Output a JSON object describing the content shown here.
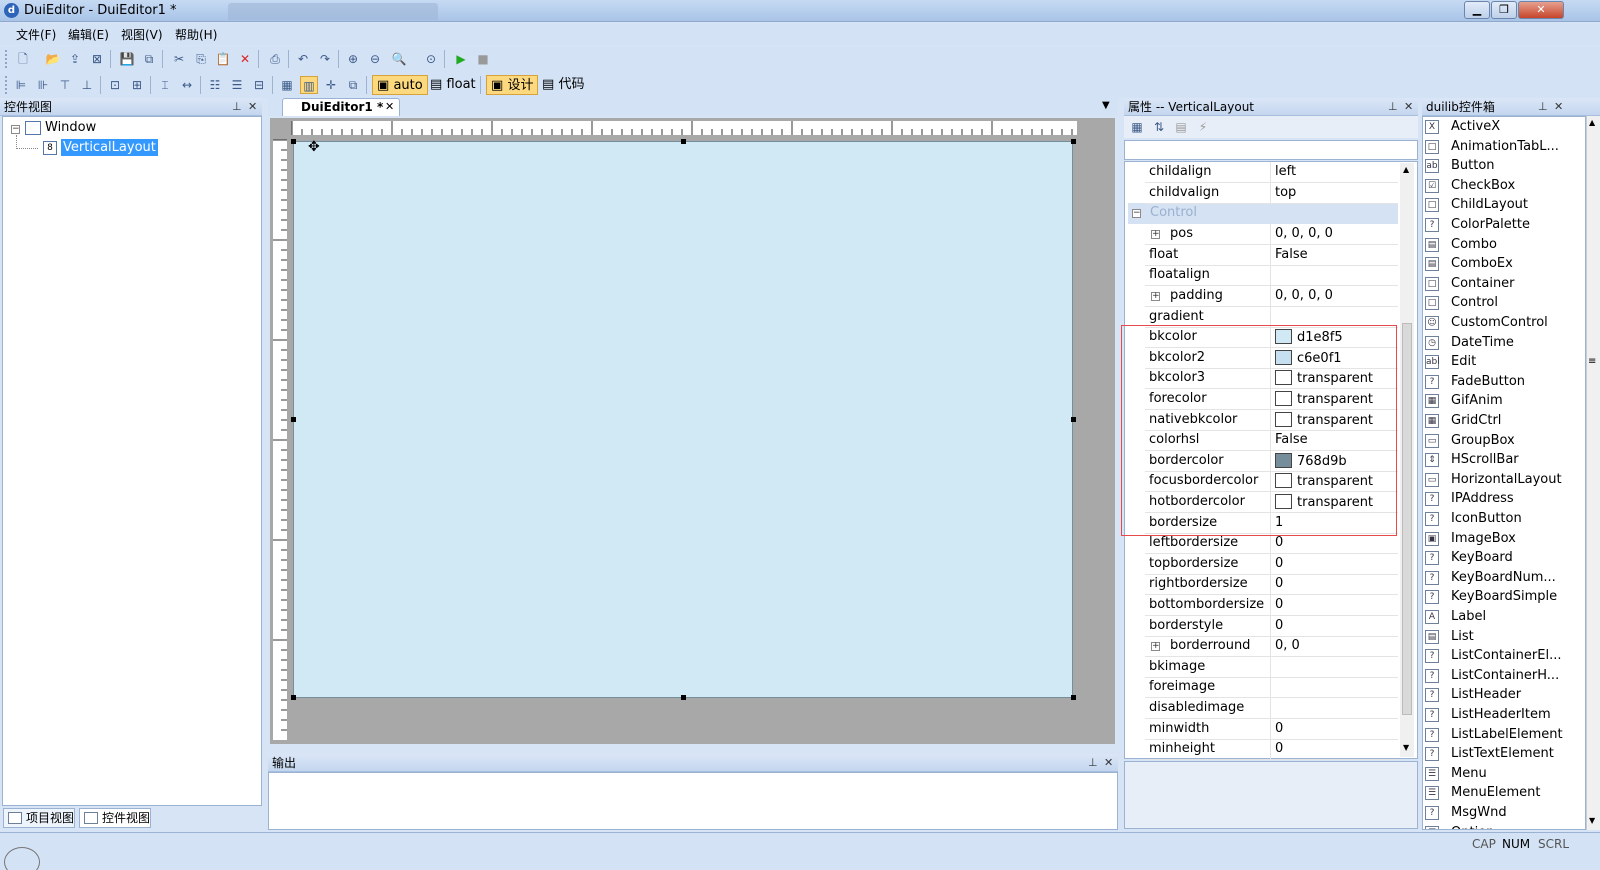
{
  "titlebar": {
    "title": "DuiEditor - DuiEditor1 *"
  },
  "menu": [
    "文件(F)",
    "编辑(E)",
    "视图(V)",
    "帮助(H)"
  ],
  "toolbar2": {
    "auto": "auto",
    "float": "float",
    "design": "设计",
    "code": "代码"
  },
  "control_view": {
    "title": "控件视图",
    "tree": [
      {
        "label": "Window"
      },
      {
        "label": "VerticalLayout"
      }
    ],
    "bottom_tabs": [
      "项目视图",
      "控件视图"
    ]
  },
  "editor": {
    "tab": "DuiEditor1 *"
  },
  "output": {
    "title": "输出"
  },
  "properties": {
    "title": "属性 -- VerticalLayout",
    "section": "Control",
    "rows": [
      {
        "name": "childalign",
        "value": "left"
      },
      {
        "name": "childvalign",
        "value": "top"
      },
      {
        "name": "pos",
        "value": "0, 0, 0, 0",
        "expander": "+"
      },
      {
        "name": "float",
        "value": "False"
      },
      {
        "name": "floatalign",
        "value": ""
      },
      {
        "name": "padding",
        "value": "0, 0, 0, 0",
        "expander": "+"
      },
      {
        "name": "gradient",
        "value": ""
      },
      {
        "name": "bkcolor",
        "value": "d1e8f5",
        "swatch": "#d1e8f5"
      },
      {
        "name": "bkcolor2",
        "value": "c6e0f1",
        "swatch": "#c6e0f1"
      },
      {
        "name": "bkcolor3",
        "value": "transparent",
        "swatch": "#ffffff"
      },
      {
        "name": "forecolor",
        "value": "transparent",
        "swatch": "#ffffff"
      },
      {
        "name": "nativebkcolor",
        "value": "transparent",
        "swatch": "#ffffff"
      },
      {
        "name": "colorhsl",
        "value": "False"
      },
      {
        "name": "bordercolor",
        "value": "768d9b",
        "swatch": "#768d9b"
      },
      {
        "name": "focusbordercolor",
        "value": "transparent",
        "swatch": "#ffffff"
      },
      {
        "name": "hotbordercolor",
        "value": "transparent",
        "swatch": "#ffffff"
      },
      {
        "name": "bordersize",
        "value": "1"
      },
      {
        "name": "leftbordersize",
        "value": "0"
      },
      {
        "name": "topbordersize",
        "value": "0"
      },
      {
        "name": "rightbordersize",
        "value": "0"
      },
      {
        "name": "bottombordersize",
        "value": "0"
      },
      {
        "name": "borderstyle",
        "value": "0"
      },
      {
        "name": "borderround",
        "value": "0, 0",
        "expander": "+"
      },
      {
        "name": "bkimage",
        "value": ""
      },
      {
        "name": "foreimage",
        "value": ""
      },
      {
        "name": "disabledimage",
        "value": ""
      },
      {
        "name": "minwidth",
        "value": "0"
      },
      {
        "name": "minheight",
        "value": "0"
      }
    ]
  },
  "toolbox": {
    "title": "duilib控件箱",
    "items": [
      "ActiveX",
      "AnimationTabL...",
      "Button",
      "CheckBox",
      "ChildLayout",
      "ColorPalette",
      "Combo",
      "ComboEx",
      "Container",
      "Control",
      "CustomControl",
      "DateTime",
      "Edit",
      "FadeButton",
      "GifAnim",
      "GridCtrl",
      "GroupBox",
      "HScrollBar",
      "HorizontalLayout",
      "IPAddress",
      "IconButton",
      "ImageBox",
      "KeyBoard",
      "KeyBoardNum...",
      "KeyBoardSimple",
      "Label",
      "List",
      "ListContainerEl...",
      "ListContainerH...",
      "ListHeader",
      "ListHeaderItem",
      "ListLabelElement",
      "ListTextElement",
      "Menu",
      "MenuElement",
      "MsgWnd",
      "Option"
    ],
    "icons": [
      "X",
      "□",
      "ab",
      "☑",
      "□",
      "?",
      "▤",
      "▤",
      "□",
      "□",
      "☺",
      "◷",
      "abl",
      "?",
      "▦",
      "▦",
      "▭",
      "⇕",
      "▭",
      "?",
      "?",
      "▣",
      "?",
      "?",
      "?",
      "A",
      "▤",
      "?",
      "?",
      "?",
      "?",
      "?",
      "?",
      "☰",
      "☰",
      "?",
      "☑"
    ]
  },
  "status": {
    "cap": "CAP",
    "num": "NUM",
    "scrl": "SCRL"
  },
  "colors": {
    "highlight": "#e8494b",
    "selection": "#3399ff"
  }
}
